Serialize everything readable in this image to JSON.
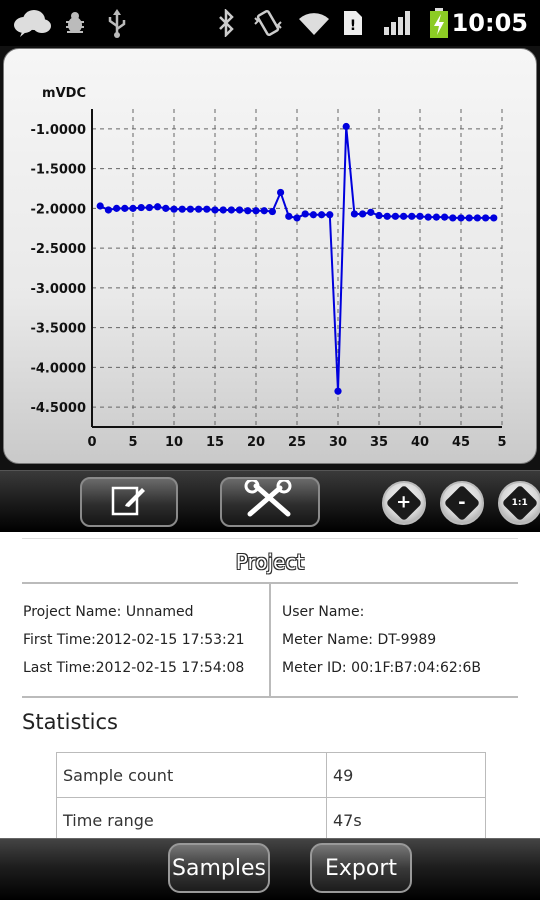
{
  "status_bar": {
    "time": "10:05",
    "icons": [
      "cloud-icon",
      "bug-icon",
      "usb-icon",
      "bluetooth-icon",
      "vibrate-icon",
      "wifi-icon",
      "sim-icon",
      "signal-icon",
      "battery-charging-icon"
    ]
  },
  "chart_data": {
    "type": "line",
    "title": "",
    "ylabel": "mVDC",
    "xlabel": "",
    "ylim": [
      -4.75,
      -0.75
    ],
    "xlim": [
      0,
      50
    ],
    "y_ticks": [
      "-1.0000",
      "-1.5000",
      "-2.0000",
      "-2.5000",
      "-3.0000",
      "-3.5000",
      "-4.0000",
      "-4.5000"
    ],
    "x_ticks": [
      "0",
      "5",
      "10",
      "15",
      "20",
      "25",
      "30",
      "35",
      "40",
      "45",
      "5"
    ],
    "grid": true,
    "series": [
      {
        "color": "#0000dd",
        "x": [
          1,
          2,
          3,
          4,
          5,
          6,
          7,
          8,
          9,
          10,
          11,
          12,
          13,
          14,
          15,
          16,
          17,
          18,
          19,
          20,
          21,
          22,
          23,
          24,
          25,
          26,
          27,
          28,
          29,
          30,
          31,
          32,
          33,
          34,
          35,
          36,
          37,
          38,
          39,
          40,
          41,
          42,
          43,
          44,
          45,
          46,
          47,
          48,
          49
        ],
        "y": [
          -1.97,
          -2.02,
          -2.0,
          -2.0,
          -2.0,
          -1.99,
          -1.99,
          -1.98,
          -2.0,
          -2.01,
          -2.01,
          -2.01,
          -2.01,
          -2.01,
          -2.02,
          -2.02,
          -2.02,
          -2.02,
          -2.03,
          -2.03,
          -2.03,
          -2.04,
          -1.8,
          -2.1,
          -2.12,
          -2.07,
          -2.08,
          -2.08,
          -2.08,
          -4.3,
          -0.97,
          -2.07,
          -2.07,
          -2.05,
          -2.09,
          -2.1,
          -2.1,
          -2.1,
          -2.1,
          -2.1,
          -2.11,
          -2.11,
          -2.11,
          -2.12,
          -2.12,
          -2.12,
          -2.12,
          -2.12,
          -2.12
        ]
      }
    ]
  },
  "toolbar": {
    "edit_icon": "edit-icon",
    "tools_icon": "tools-icon",
    "zoom_in_glyph": "+",
    "zoom_out_glyph": "-",
    "zoom_reset_glyph": "1:1"
  },
  "project": {
    "heading": "Project",
    "project_name": "Project Name: Unnamed",
    "first_time": "First Time:2012-02-15 17:53:21",
    "last_time": "Last Time:2012-02-15 17:54:08",
    "user_name": "User Name:",
    "meter_name": "Meter Name: DT-9989",
    "meter_id": "Meter ID: 00:1F:B7:04:62:6B"
  },
  "statistics": {
    "heading": "Statistics",
    "rows": [
      {
        "label": "Sample count",
        "value": "49"
      },
      {
        "label": "Time range",
        "value": "47s"
      }
    ]
  },
  "bottom_bar": {
    "samples_label": "Samples",
    "export_label": "Export"
  }
}
